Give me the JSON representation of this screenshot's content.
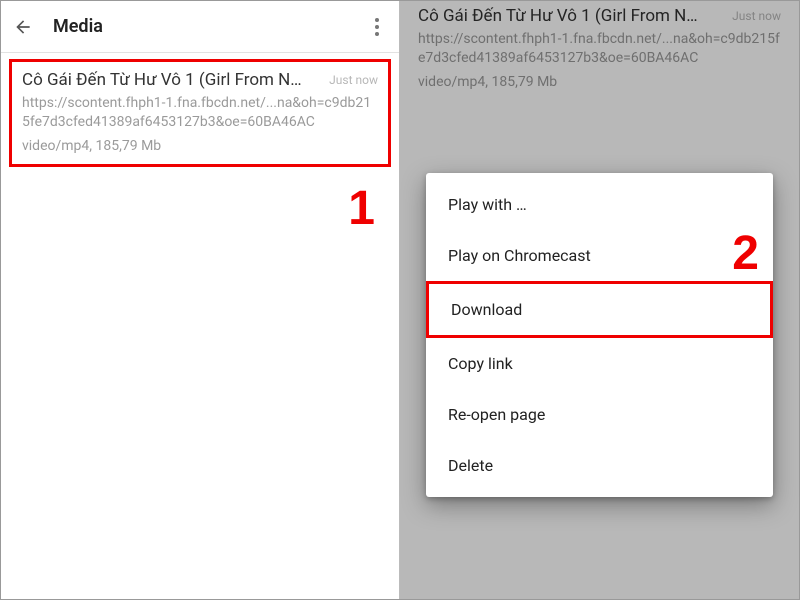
{
  "left": {
    "header": {
      "title": "Media"
    },
    "item": {
      "title": "Cô Gái Đến Từ Hư Vô 1 (Girl From N…",
      "time": "Just now",
      "url": "https://scontent.fhph1-1.fna.fbcdn.net/...na&oh=c9db215fe7d3cfed41389af6453127b3&oe=60BA46AC",
      "meta": "video/mp4, 185,79 Mb"
    },
    "step": "1"
  },
  "right": {
    "item": {
      "title": "Cô Gái Đến Từ Hư Vô 1 (Girl From N…",
      "time": "Just now",
      "url": "https://scontent.fhph1-1.fna.fbcdn.net/...na&oh=c9db215fe7d3cfed41389af6453127b3&oe=60BA46AC",
      "meta": "video/mp4, 185,79 Mb"
    },
    "menu": {
      "items": [
        "Play with …",
        "Play on Chromecast",
        "Download",
        "Copy link",
        "Re-open page",
        "Delete"
      ]
    },
    "step": "2"
  }
}
